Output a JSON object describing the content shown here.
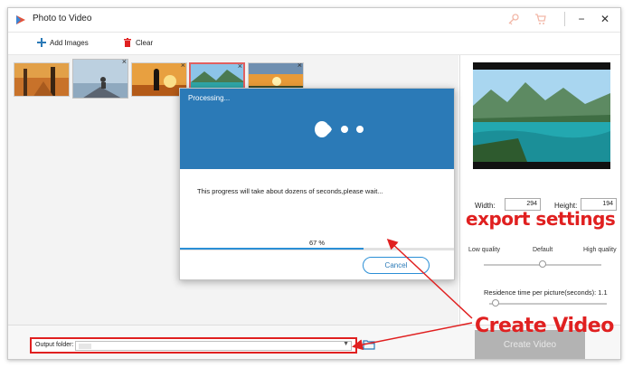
{
  "window": {
    "title": "Photo to Video",
    "minimize": "−",
    "close": "✕"
  },
  "toolbar": {
    "add_images": "Add Images",
    "clear": "Clear"
  },
  "thumbnails": [
    {
      "name": "autumn-forest",
      "selected": false
    },
    {
      "name": "person-on-rock",
      "selected": false
    },
    {
      "name": "sunset-photographer",
      "selected": false
    },
    {
      "name": "lake-landscape",
      "selected": true
    },
    {
      "name": "sunset-clouds",
      "selected": false
    }
  ],
  "dialog": {
    "title": "Processing...",
    "message": "This progress will take about dozens of seconds,please wait...",
    "progress_value": 0.67,
    "progress_text": "67 %",
    "cancel": "Cancel"
  },
  "settings": {
    "width_label": "Width:",
    "width_value": "294",
    "height_label": "Height:",
    "height_value": "194",
    "quality_low": "Low quality",
    "quality_default": "Default",
    "quality_high": "High quality",
    "quality_level": 0.5,
    "residence_label": "Residence time per picture(seconds): 1.1",
    "residence_level": 0.05
  },
  "bottom": {
    "output_label": "Output folder:",
    "create_button": "Create Video"
  },
  "annotations": {
    "export_settings": "export settings",
    "create_video": "Create Video",
    "color": "#e02020"
  },
  "colors": {
    "accent": "#2b7ab7",
    "progress": "#2b8fd6",
    "highlight": "#e02020"
  }
}
